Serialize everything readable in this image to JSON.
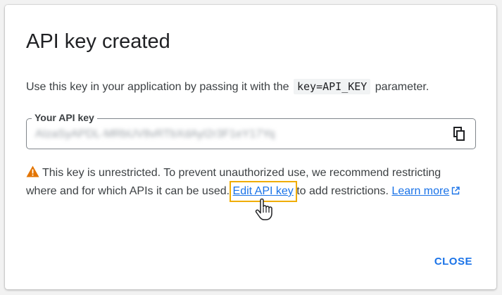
{
  "dialog": {
    "title": "API key created",
    "instruction_prefix": "Use this key in your application by passing it with the",
    "instruction_code": "key=API_KEY",
    "instruction_suffix": "parameter.",
    "key_field": {
      "label": "Your API key",
      "value": "AIzaSyAPDL-MRbUV8vRTbXdAyI2r3F1eY17Yq"
    },
    "warning": {
      "line1": "This key is unrestricted. To prevent unauthorized use, we recommend restricting",
      "line2_prefix": "where and for which APIs it can be used.",
      "edit_link": "Edit API key",
      "line2_middle": "to add restrictions.",
      "learn_more": "Learn more"
    },
    "close_label": "CLOSE"
  },
  "colors": {
    "accent": "#1a73e8",
    "warning": "#e37400",
    "highlight": "#f0ad00"
  },
  "icons": {
    "copy": "copy-icon",
    "warning": "warning-icon",
    "external": "external-link-icon",
    "cursor": "hand-pointer-cursor"
  }
}
